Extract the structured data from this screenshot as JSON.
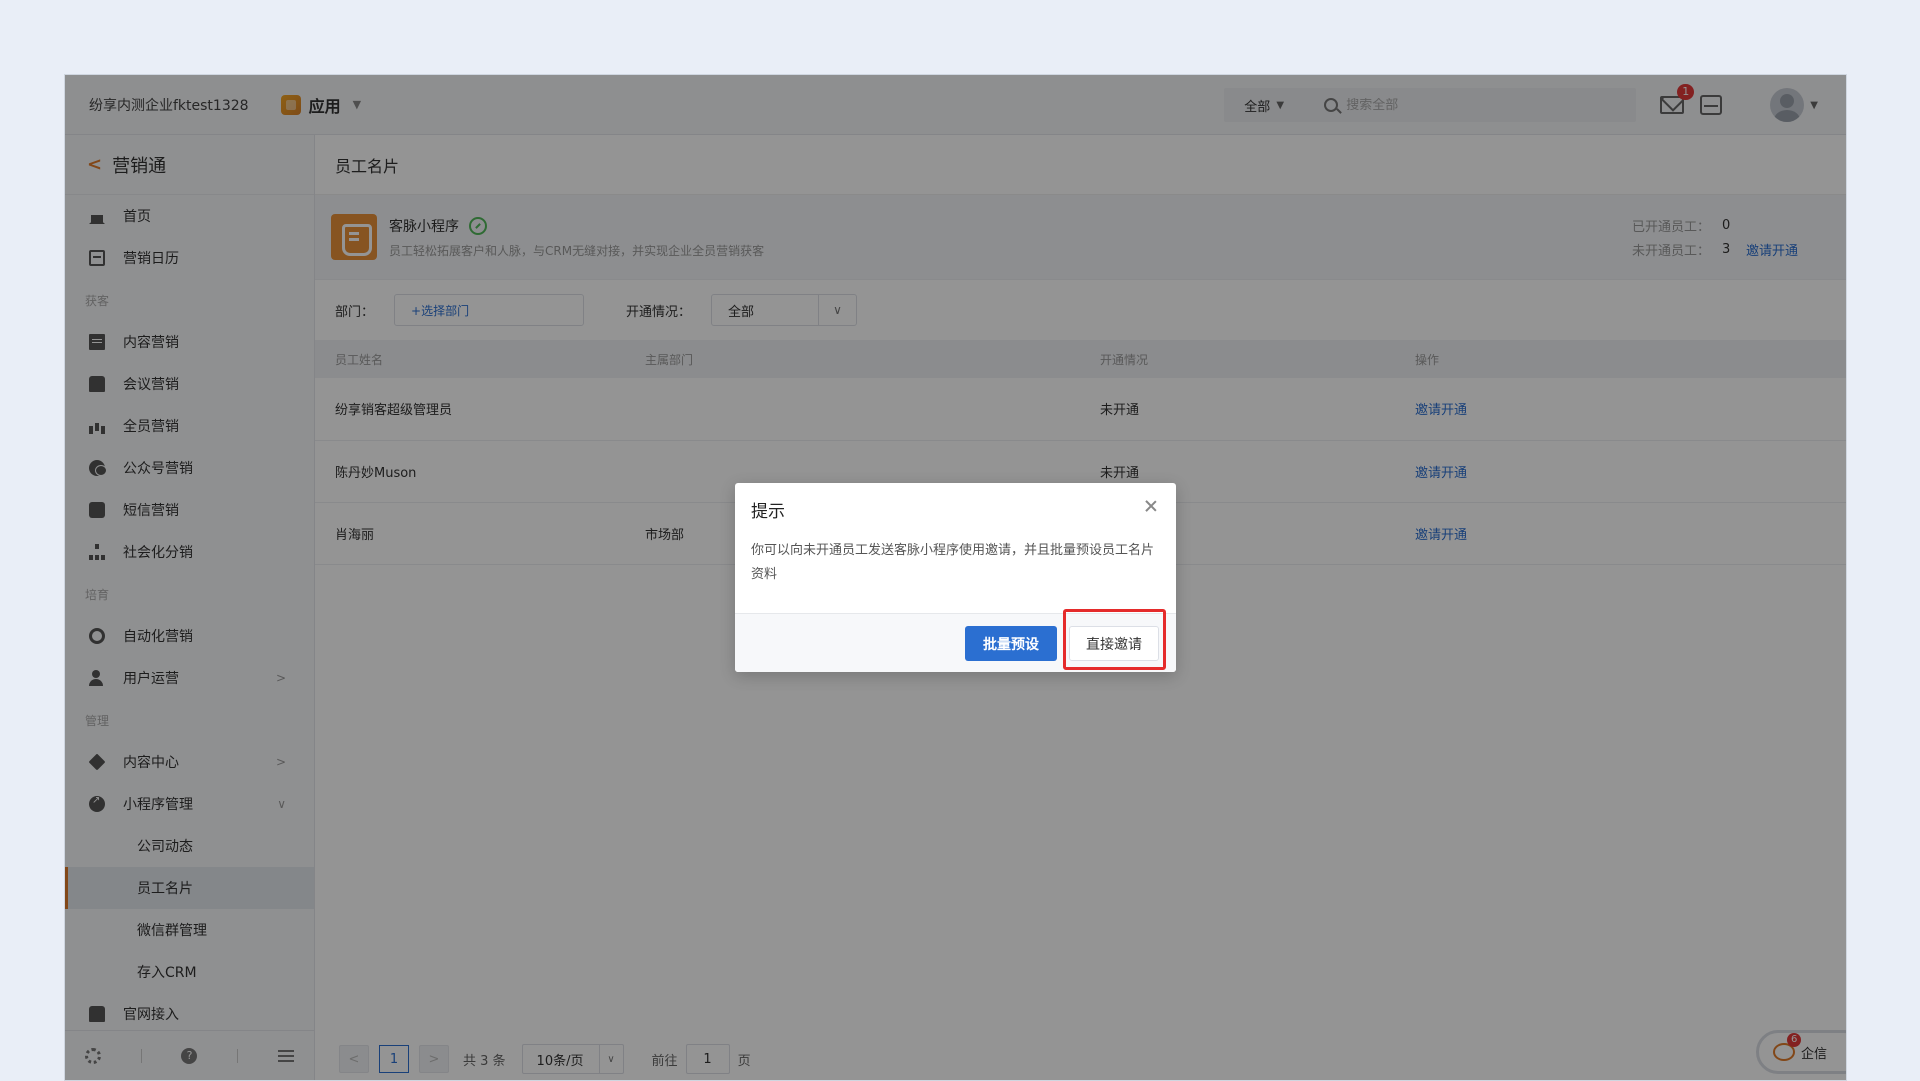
{
  "header": {
    "company": "纷享内测企业fktest1328",
    "app_label": "应用",
    "search_scope": "全部",
    "search_placeholder": "搜索全部",
    "mail_badge": "1"
  },
  "sidebar": {
    "title": "营销通",
    "top_items": [
      {
        "label": "首页",
        "icon": "home-icon"
      },
      {
        "label": "营销日历",
        "icon": "calendar-icon"
      }
    ],
    "group_acquire": "获客",
    "acquire_items": [
      {
        "label": "内容营销",
        "icon": "document-icon"
      },
      {
        "label": "会议营销",
        "icon": "meeting-icon"
      },
      {
        "label": "全员营销",
        "icon": "team-icon"
      },
      {
        "label": "公众号营销",
        "icon": "wechat-icon"
      },
      {
        "label": "短信营销",
        "icon": "sms-icon"
      },
      {
        "label": "社会化分销",
        "icon": "org-chart-icon"
      }
    ],
    "group_nurture": "培育",
    "nurture_items": [
      {
        "label": "自动化营销",
        "icon": "automation-icon"
      },
      {
        "label": "用户运营",
        "icon": "user-icon"
      }
    ],
    "group_manage": "管理",
    "manage_items": [
      {
        "label": "内容中心",
        "icon": "layers-icon"
      },
      {
        "label": "小程序管理",
        "icon": "mini-program-icon"
      }
    ],
    "sub_items": [
      "公司动态",
      "员工名片",
      "微信群管理",
      "存入CRM"
    ],
    "partial_item": "官网接入"
  },
  "main": {
    "page_title": "员工名片",
    "promo": {
      "title": "客脉小程序",
      "desc": "员工轻松拓展客户和人脉，与CRM无缝对接，并实现企业全员营销获客",
      "opened_label": "已开通员工：",
      "opened_count": "0",
      "unopened_label": "未开通员工：",
      "unopened_count": "3",
      "invite_all": "邀请开通"
    },
    "filters": {
      "dept_label": "部门：",
      "dept_placeholder": "+选择部门",
      "status_label": "开通情况：",
      "status_value": "全部"
    },
    "table": {
      "headers": [
        "员工姓名",
        "主属部门",
        "开通情况",
        "操作"
      ],
      "rows": [
        {
          "name": "纷享销客超级管理员",
          "dept": "",
          "status": "未开通",
          "op": "邀请开通"
        },
        {
          "name": "陈丹妙Muson",
          "dept": "",
          "status": "未开通",
          "op": "邀请开通"
        },
        {
          "name": "肖海丽",
          "dept": "市场部",
          "status": "",
          "op": "邀请开通"
        }
      ]
    },
    "pager": {
      "current": "1",
      "total": "共 3 条",
      "page_size": "10条/页",
      "goto_label": "前往",
      "goto_value": "1",
      "page_unit": "页"
    }
  },
  "qixin": {
    "label": "企信",
    "badge": "6"
  },
  "modal": {
    "title": "提示",
    "body": "你可以向未开通员工发送客脉小程序使用邀请，并且批量预设员工名片资料",
    "primary_label": "批量预设",
    "secondary_label": "直接邀请"
  }
}
